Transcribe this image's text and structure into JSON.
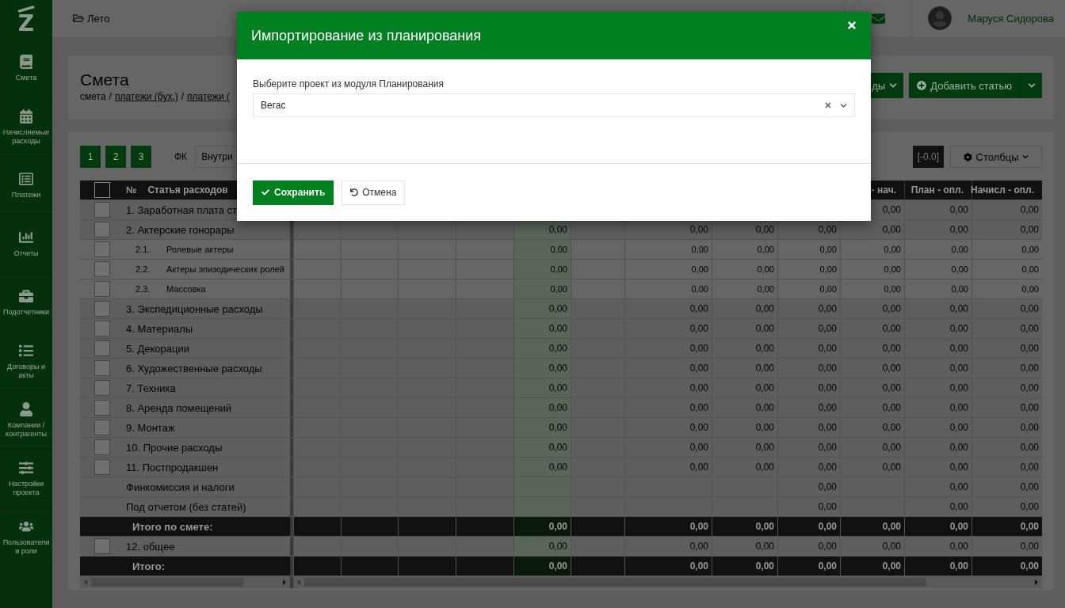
{
  "app": {
    "logo": "Z",
    "project": "Лето",
    "user": "Маруся Сидорова"
  },
  "sidebar": {
    "items": [
      {
        "kind": "book",
        "label": "Смета"
      },
      {
        "kind": "calendar",
        "label": "Начисляемые расходы"
      },
      {
        "kind": "table",
        "label": "Платежи"
      },
      {
        "kind": "chart",
        "label": "Отчеты"
      },
      {
        "kind": "briefcase",
        "label": "Подотчетники"
      },
      {
        "kind": "list",
        "label": "Договоры и акты"
      },
      {
        "kind": "user",
        "label": "Компании / контрагенты"
      },
      {
        "kind": "sliders",
        "label": "Настройки проекта"
      },
      {
        "kind": "users",
        "label": "Пользователи и роли"
      }
    ]
  },
  "page": {
    "title": "Смета",
    "breadcrumb": [
      {
        "kind": "text",
        "text": "смета"
      },
      {
        "kind": "sep",
        "text": "/"
      },
      {
        "kind": "link",
        "text": "платежи (бух.)"
      },
      {
        "kind": "sep",
        "text": "/"
      },
      {
        "kind": "link",
        "text": "платежи ("
      }
    ],
    "actions": [
      {
        "kind": "dropdown",
        "label": "ды"
      },
      {
        "kind": "add",
        "label": "Добавить статью"
      }
    ]
  },
  "toolbar": {
    "pages": [
      "1",
      "2",
      "3"
    ],
    "filter_label": "ФК",
    "filter_value": "Внутри",
    "precision": "[-0.0]",
    "columns_button": "Столбцы"
  },
  "table": {
    "header": {
      "checked": false,
      "number": "№",
      "name": "Статья расходов",
      "columns": {
        "column_10": "- нач.",
        "column_11": "План - опл.",
        "column_12": "Начисл - опл."
      }
    },
    "rows": [
      {
        "kind": "category",
        "checked": false,
        "name": "1. Заработная плата ст",
        "values": {
          "column_10": "0,00",
          "column_11": "0,00",
          "column_12": "0,00"
        }
      },
      {
        "kind": "category",
        "checked": false,
        "name": "2. Актерские гонорары",
        "values": {
          "column_5": "0,00",
          "column_7": "0,00",
          "column_8": "0,00",
          "column_9": "0,00",
          "column_10": "0,00",
          "column_11": "0,00",
          "column_12": "0,00"
        }
      },
      {
        "kind": "sub",
        "checked": false,
        "number": "2.1.",
        "name": "Ролевые актеры",
        "values": {
          "column_5": "0,00",
          "column_7": "0,00",
          "column_8": "0,00",
          "column_9": "0,00",
          "column_10": "0,00",
          "column_11": "0,00",
          "column_12": "0,00"
        }
      },
      {
        "kind": "sub",
        "checked": false,
        "number": "2.2.",
        "name": "Актеры эпизодических ролей",
        "values": {
          "column_5": "0,00",
          "column_7": "0,00",
          "column_8": "0,00",
          "column_9": "0,00",
          "column_10": "0,00",
          "column_11": "0,00",
          "column_12": "0,00"
        }
      },
      {
        "kind": "sub",
        "checked": false,
        "number": "2.3.",
        "name": "Массовка",
        "values": {
          "column_5": "0,00",
          "column_7": "0,00",
          "column_8": "0,00",
          "column_9": "0,00",
          "column_10": "0,00",
          "column_11": "0,00",
          "column_12": "0,00"
        }
      },
      {
        "kind": "category",
        "checked": false,
        "name": "3. Экспедиционные расходы",
        "values": {
          "column_5": "0,00",
          "column_7": "0,00",
          "column_8": "0,00",
          "column_9": "0,00",
          "column_10": "0,00",
          "column_11": "0,00",
          "column_12": "0,00"
        }
      },
      {
        "kind": "category",
        "checked": false,
        "name": "4. Материалы",
        "values": {
          "column_5": "0,00",
          "column_7": "0,00",
          "column_8": "0,00",
          "column_9": "0,00",
          "column_10": "0,00",
          "column_11": "0,00",
          "column_12": "0,00"
        }
      },
      {
        "kind": "category",
        "checked": false,
        "name": "5. Декорации",
        "values": {
          "column_5": "0,00",
          "column_7": "0,00",
          "column_8": "0,00",
          "column_9": "0,00",
          "column_10": "0,00",
          "column_11": "0,00",
          "column_12": "0,00"
        }
      },
      {
        "kind": "category",
        "checked": false,
        "name": "6. Художественные расходы",
        "values": {
          "column_5": "0,00",
          "column_7": "0,00",
          "column_8": "0,00",
          "column_9": "0,00",
          "column_10": "0,00",
          "column_11": "0,00",
          "column_12": "0,00"
        }
      },
      {
        "kind": "category",
        "checked": false,
        "name": "7. Техника",
        "values": {
          "column_5": "0,00",
          "column_7": "0,00",
          "column_8": "0,00",
          "column_9": "0,00",
          "column_10": "0,00",
          "column_11": "0,00",
          "column_12": "0,00"
        }
      },
      {
        "kind": "category",
        "checked": false,
        "name": "8. Аренда помещений",
        "values": {
          "column_5": "0,00",
          "column_7": "0,00",
          "column_8": "0,00",
          "column_9": "0,00",
          "column_10": "0,00",
          "column_11": "0,00",
          "column_12": "0,00"
        }
      },
      {
        "kind": "category",
        "checked": false,
        "name": "9. Монтаж",
        "values": {
          "column_5": "0,00",
          "column_7": "0,00",
          "column_8": "0,00",
          "column_9": "0,00",
          "column_10": "0,00",
          "column_11": "0,00",
          "column_12": "0,00"
        }
      },
      {
        "kind": "category",
        "checked": false,
        "name": "10. Прочие расходы",
        "values": {
          "column_5": "0,00",
          "column_7": "0,00",
          "column_8": "0,00",
          "column_9": "0,00",
          "column_10": "0,00",
          "column_11": "0,00",
          "column_12": "0,00"
        }
      },
      {
        "kind": "category",
        "checked": false,
        "name": "11. Постпродакшен",
        "values": {
          "column_5": "0,00",
          "column_7": "0,00",
          "column_8": "0,00",
          "column_9": "0,00",
          "column_10": "0,00",
          "column_11": "0,00",
          "column_12": "0,00"
        }
      },
      {
        "kind": "summary",
        "name": "Финкомиссия и налоги",
        "values": {
          "column_9": "0,00",
          "column_11": "0,00",
          "column_12": "0,00"
        }
      },
      {
        "kind": "summary",
        "name": "Под отчетом (без статей)",
        "values": {
          "column_9": "0,00",
          "column_11": "0,00",
          "column_12": "0,00"
        }
      },
      {
        "kind": "total",
        "name": "Итого по смете:",
        "values": {
          "column_5": "0,00",
          "column_7": "0,00",
          "column_8": "0,00",
          "column_9": "0,00",
          "column_10": "0,00",
          "column_11": "0,00",
          "column_12": "0,00"
        }
      },
      {
        "kind": "category",
        "checked": false,
        "name": "12. общее",
        "values": {
          "column_5": "0,00",
          "column_7": "0,00",
          "column_8": "0,00",
          "column_9": "0,00",
          "column_10": "0,00",
          "column_11": "0,00",
          "column_12": "0,00"
        }
      },
      {
        "kind": "total",
        "name": "Итого:",
        "values": {
          "column_5": "0,00",
          "column_7": "0,00",
          "column_8": "0,00",
          "column_9": "0,00",
          "column_10": "0,00",
          "column_11": "0,00",
          "column_12": "0,00"
        }
      }
    ]
  },
  "modal": {
    "title": "Импортирование из планирования",
    "field_label": "Выберите проект из модуля Планирования",
    "value": "Вегас",
    "save": "Сохранить",
    "cancel": "Отмена"
  }
}
